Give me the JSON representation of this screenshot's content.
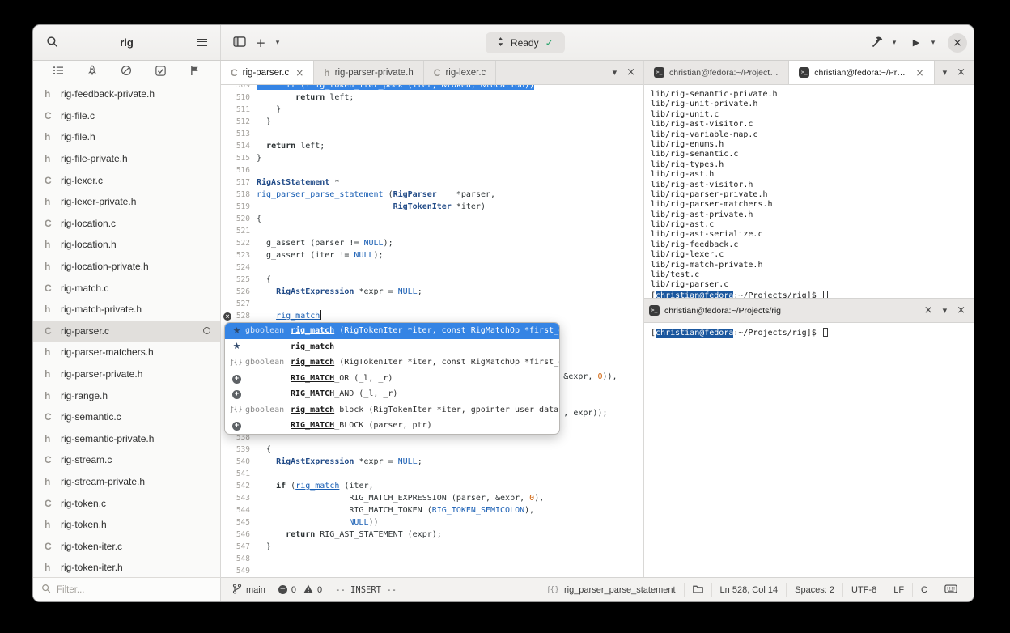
{
  "glyphs": {
    "close": "×",
    "chevron_down": "▾",
    "play": "▶",
    "plus": "+",
    "star": "★",
    "check": "✓",
    "minus": "−",
    "func": "ƒ{}",
    "terminal_prompt": ">_"
  },
  "header": {
    "title": "rig",
    "omnibar_label": "Ready"
  },
  "sidebar": {
    "tools": [
      "project-tree",
      "build-pipeline",
      "diagnostics",
      "todo",
      "flags"
    ],
    "filter_placeholder": "Filter...",
    "files": [
      {
        "type": "h",
        "name": "rig-feedback-private.h"
      },
      {
        "type": "C",
        "name": "rig-file.c"
      },
      {
        "type": "h",
        "name": "rig-file.h"
      },
      {
        "type": "h",
        "name": "rig-file-private.h"
      },
      {
        "type": "C",
        "name": "rig-lexer.c"
      },
      {
        "type": "h",
        "name": "rig-lexer-private.h"
      },
      {
        "type": "C",
        "name": "rig-location.c"
      },
      {
        "type": "h",
        "name": "rig-location.h"
      },
      {
        "type": "h",
        "name": "rig-location-private.h"
      },
      {
        "type": "C",
        "name": "rig-match.c"
      },
      {
        "type": "h",
        "name": "rig-match-private.h"
      },
      {
        "type": "C",
        "name": "rig-parser.c",
        "selected": true,
        "open_indicator": true
      },
      {
        "type": "h",
        "name": "rig-parser-matchers.h"
      },
      {
        "type": "h",
        "name": "rig-parser-private.h"
      },
      {
        "type": "h",
        "name": "rig-range.h"
      },
      {
        "type": "C",
        "name": "rig-semantic.c"
      },
      {
        "type": "h",
        "name": "rig-semantic-private.h"
      },
      {
        "type": "C",
        "name": "rig-stream.c"
      },
      {
        "type": "h",
        "name": "rig-stream-private.h"
      },
      {
        "type": "C",
        "name": "rig-token.c"
      },
      {
        "type": "h",
        "name": "rig-token.h"
      },
      {
        "type": "C",
        "name": "rig-token-iter.c"
      },
      {
        "type": "h",
        "name": "rig-token-iter.h"
      }
    ]
  },
  "editor": {
    "tabs": [
      {
        "type": "C",
        "label": "rig-parser.c",
        "active": true,
        "close": true
      },
      {
        "type": "h",
        "label": "rig-parser-private.h"
      },
      {
        "type": "C",
        "label": "rig-lexer.c"
      }
    ],
    "lines": [
      {
        "n": 509,
        "seg": [
          [
            "selline",
            "      if (!rig_token_iter_peek (iter, &token, &location))"
          ]
        ]
      },
      {
        "n": 510,
        "seg": [
          [
            "p",
            "        "
          ],
          [
            "kw",
            "return"
          ],
          [
            "p",
            " left;"
          ]
        ]
      },
      {
        "n": 511,
        "seg": [
          [
            "p",
            "    }"
          ]
        ]
      },
      {
        "n": 512,
        "seg": [
          [
            "p",
            "  }"
          ]
        ]
      },
      {
        "n": 513,
        "seg": []
      },
      {
        "n": 514,
        "seg": [
          [
            "p",
            "  "
          ],
          [
            "kw",
            "return"
          ],
          [
            "p",
            " left;"
          ]
        ]
      },
      {
        "n": 515,
        "seg": [
          [
            "p",
            "}"
          ]
        ]
      },
      {
        "n": 516,
        "seg": []
      },
      {
        "n": 517,
        "seg": [
          [
            "type",
            "RigAstStatement"
          ],
          [
            "p",
            " *"
          ]
        ]
      },
      {
        "n": 518,
        "seg": [
          [
            "fn",
            "rig_parser_parse_statement"
          ],
          [
            "p",
            " ("
          ],
          [
            "type",
            "RigParser"
          ],
          [
            "p",
            "    *parser,"
          ]
        ]
      },
      {
        "n": 519,
        "seg": [
          [
            "p",
            "                            "
          ],
          [
            "type",
            "RigTokenIter"
          ],
          [
            "p",
            " *iter)"
          ]
        ]
      },
      {
        "n": 520,
        "seg": [
          [
            "p",
            "{"
          ]
        ]
      },
      {
        "n": 521,
        "seg": []
      },
      {
        "n": 522,
        "seg": [
          [
            "p",
            "  g_assert (parser != "
          ],
          [
            "const",
            "NULL"
          ],
          [
            "p",
            ");"
          ]
        ]
      },
      {
        "n": 523,
        "seg": [
          [
            "p",
            "  g_assert (iter != "
          ],
          [
            "const",
            "NULL"
          ],
          [
            "p",
            ");"
          ]
        ]
      },
      {
        "n": 524,
        "seg": []
      },
      {
        "n": 525,
        "seg": [
          [
            "p",
            "  {"
          ]
        ]
      },
      {
        "n": 526,
        "seg": [
          [
            "p",
            "    "
          ],
          [
            "type",
            "RigAstExpression"
          ],
          [
            "p",
            " *expr = "
          ],
          [
            "const",
            "NULL"
          ],
          [
            "p",
            ";"
          ]
        ]
      },
      {
        "n": 527,
        "seg": []
      },
      {
        "n": 528,
        "cursor": true,
        "mark": true,
        "seg": [
          [
            "p",
            "    "
          ],
          [
            "fn",
            "rig_match"
          ]
        ]
      },
      {
        "n": 529,
        "seg": []
      },
      {
        "n": 530,
        "seg": []
      },
      {
        "n": 531,
        "seg": []
      },
      {
        "n": 532,
        "seg": []
      },
      {
        "n": 533,
        "seg": [
          [
            "p",
            "                                                               &expr, "
          ],
          [
            "num",
            "0"
          ],
          [
            "p",
            ")),"
          ]
        ]
      },
      {
        "n": 534,
        "seg": []
      },
      {
        "n": 535,
        "seg": []
      },
      {
        "n": 536,
        "seg": [
          [
            "p",
            "                                                               , expr));"
          ]
        ]
      },
      {
        "n": 537,
        "seg": []
      },
      {
        "n": 538,
        "seg": []
      },
      {
        "n": 539,
        "seg": [
          [
            "p",
            "  {"
          ]
        ]
      },
      {
        "n": 540,
        "seg": [
          [
            "p",
            "    "
          ],
          [
            "type",
            "RigAstExpression"
          ],
          [
            "p",
            " *expr = "
          ],
          [
            "const",
            "NULL"
          ],
          [
            "p",
            ";"
          ]
        ]
      },
      {
        "n": 541,
        "seg": []
      },
      {
        "n": 542,
        "seg": [
          [
            "p",
            "    "
          ],
          [
            "kw",
            "if"
          ],
          [
            "p",
            " ("
          ],
          [
            "fn",
            "rig_match"
          ],
          [
            "p",
            " (iter,"
          ]
        ]
      },
      {
        "n": 543,
        "seg": [
          [
            "p",
            "                   RIG_MATCH_EXPRESSION (parser, &expr, "
          ],
          [
            "num",
            "0"
          ],
          [
            "p",
            "),"
          ]
        ]
      },
      {
        "n": 544,
        "seg": [
          [
            "p",
            "                   RIG_MATCH_TOKEN ("
          ],
          [
            "const",
            "RIG_TOKEN_SEMICOLON"
          ],
          [
            "p",
            "),"
          ]
        ]
      },
      {
        "n": 545,
        "seg": [
          [
            "p",
            "                   "
          ],
          [
            "const",
            "NULL"
          ],
          [
            "p",
            "))"
          ]
        ]
      },
      {
        "n": 546,
        "seg": [
          [
            "p",
            "      "
          ],
          [
            "kw",
            "return"
          ],
          [
            "p",
            " RIG_AST_STATEMENT (expr);"
          ]
        ]
      },
      {
        "n": 547,
        "seg": [
          [
            "p",
            "  }"
          ]
        ]
      },
      {
        "n": 548,
        "seg": []
      },
      {
        "n": 549,
        "seg": []
      }
    ],
    "completion": {
      "rows": [
        {
          "icon": "star",
          "selected": true,
          "rtype": "gboolean",
          "match": "rig_match",
          "rest": " (RigTokenIter *iter, const RigMatchOp *first_op, ...)"
        },
        {
          "icon": "star",
          "rtype": "",
          "match": "rig_match",
          "rest": ""
        },
        {
          "icon": "func",
          "rtype": "gboolean",
          "match": "rig_match",
          "rest": " (RigTokenIter *iter, const RigMatchOp *first_op, ...)"
        },
        {
          "icon": "macro",
          "rtype": "",
          "match": "RIG_MATCH",
          "rest": "_OR (_l, _r)"
        },
        {
          "icon": "macro",
          "rtype": "",
          "match": "RIG_MATCH",
          "rest": "_AND (_l, _r)"
        },
        {
          "icon": "func",
          "rtype": "gboolean",
          "match": "rig_match",
          "rest": "_block (RigTokenIter *iter, gpointer user_data)"
        },
        {
          "icon": "macro",
          "rtype": "",
          "match": "RIG_MATCH",
          "rest": "_BLOCK (parser, ptr)"
        }
      ]
    }
  },
  "terminals": {
    "top": {
      "tabs": [
        {
          "label": "christian@fedora:~/Projects/rig"
        },
        {
          "label": "christian@fedora:~/Projects",
          "active": true,
          "close": true
        }
      ],
      "output": [
        "lib/rig-semantic-private.h",
        "lib/rig-unit-private.h",
        "lib/rig-unit.c",
        "lib/rig-ast-visitor.c",
        "lib/rig-variable-map.c",
        "lib/rig-enums.h",
        "lib/rig-semantic.c",
        "lib/rig-types.h",
        "lib/rig-ast.h",
        "lib/rig-ast-visitor.h",
        "lib/rig-parser-private.h",
        "lib/rig-parser-matchers.h",
        "lib/rig-ast-private.h",
        "lib/rig-ast.c",
        "lib/rig-ast-serialize.c",
        "lib/rig-feedback.c",
        "lib/rig-lexer.c",
        "lib/rig-match-private.h",
        "lib/test.c",
        "lib/rig-parser.c"
      ],
      "prompt": {
        "prefix": "[",
        "user": "christian@fedora",
        "suffix": ":~/Projects/rig]$ "
      }
    },
    "bottom": {
      "title": "christian@fedora:~/Projects/rig",
      "prompt": {
        "prefix": "[",
        "user": "christian@fedora",
        "suffix": ":~/Projects/rig]$ "
      }
    }
  },
  "statusbar": {
    "branch_label": "main",
    "error_count": "0",
    "warning_count": "0",
    "mode": "-- INSERT --",
    "symbol": "rig_parser_parse_statement",
    "position": "Ln 528, Col 14",
    "indent": "Spaces: 2",
    "encoding": "UTF-8",
    "line_ending": "LF",
    "language": "C"
  }
}
